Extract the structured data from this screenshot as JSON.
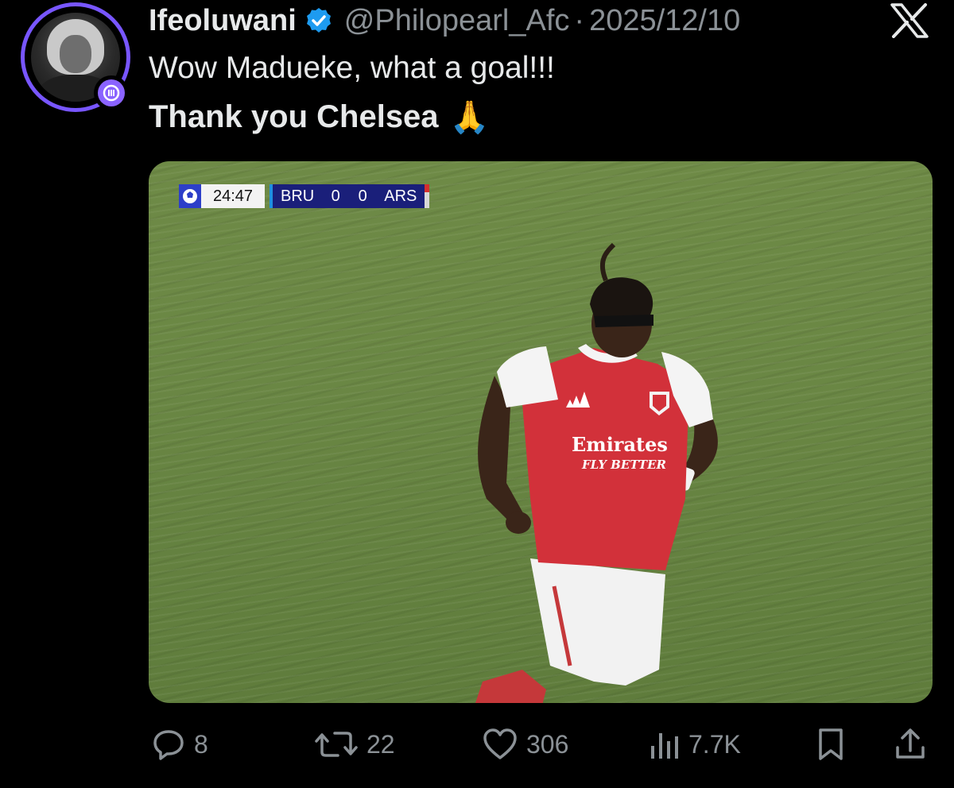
{
  "tweet": {
    "author_name": "Ifeoluwani",
    "handle": "@Philopearl_Afc",
    "separator": "·",
    "date": "2025/12/10",
    "text_line1": "Wow Madueke, what a goal!!!",
    "text_line2": "Thank you Chelsea",
    "emoji": "🙏",
    "verified": true,
    "accent_color": "#7856ff",
    "verified_color": "#1d9bf0"
  },
  "media": {
    "scorebug": {
      "time": "24:47",
      "home": "BRU",
      "home_score": "0",
      "away_score": "0",
      "away": "ARS"
    },
    "shirt_sponsor": "Emirates",
    "shirt_tagline": "FLY BETTER"
  },
  "actions": {
    "replies": "8",
    "retweets": "22",
    "likes": "306",
    "views": "7.7K"
  },
  "icons": [
    "reply-icon",
    "retweet-icon",
    "like-icon",
    "views-icon",
    "bookmark-icon",
    "share-icon",
    "verified-icon",
    "x-logo-icon"
  ]
}
